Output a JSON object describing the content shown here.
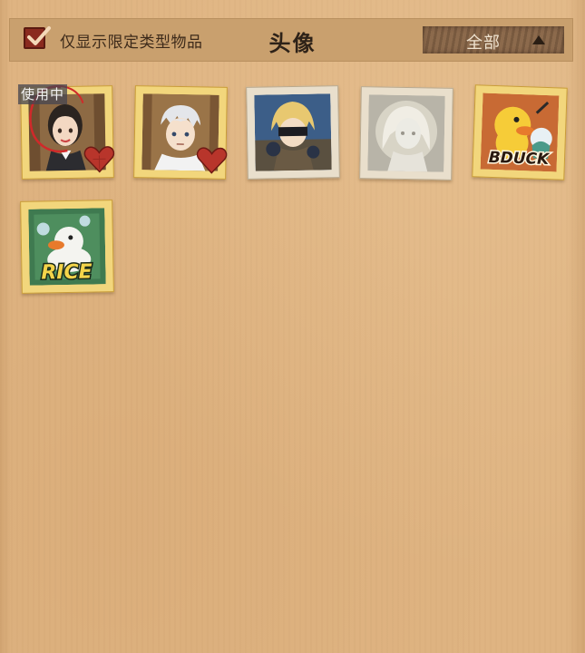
{
  "header": {
    "filter_label": "仅显示限定类型物品",
    "filter_checked": true,
    "title": "头像",
    "dropdown_label": "全部"
  },
  "in_use_badge": "使用中",
  "avatars": [
    {
      "name": "avatar-isabella",
      "frame": "gold",
      "favorite": true,
      "in_use": true,
      "selected": true
    },
    {
      "name": "avatar-norman",
      "frame": "gold",
      "favorite": true,
      "in_use": false,
      "selected": false
    },
    {
      "name": "avatar-masked-character",
      "frame": "silver",
      "favorite": false,
      "in_use": false,
      "selected": false
    },
    {
      "name": "avatar-white-statue",
      "frame": "silver",
      "favorite": false,
      "in_use": false,
      "selected": false
    },
    {
      "name": "avatar-bduck",
      "frame": "gold",
      "favorite": false,
      "in_use": false,
      "selected": false,
      "logo_text": "BDUCK"
    },
    {
      "name": "avatar-rice-duck",
      "frame": "gold",
      "favorite": false,
      "in_use": false,
      "selected": false,
      "logo_text": "RICE"
    }
  ],
  "colors": {
    "background": "#dfb482",
    "header": "#c9a06e",
    "accent_red": "#a8322a",
    "gold_frame": "#f2d67c"
  }
}
